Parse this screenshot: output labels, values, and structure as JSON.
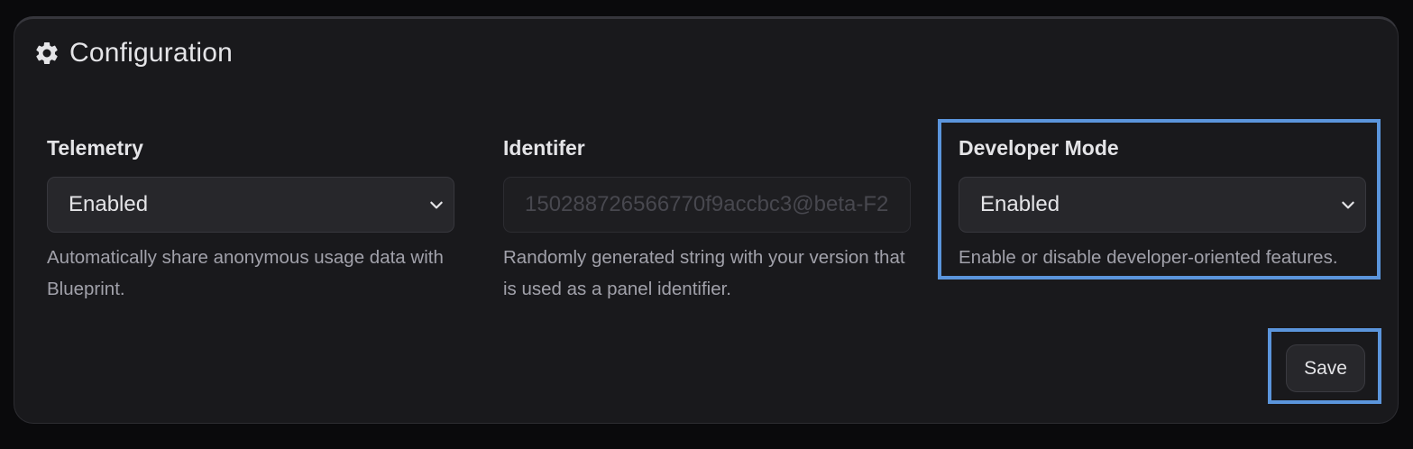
{
  "card": {
    "title": "Configuration",
    "icon": "gear-icon"
  },
  "fields": [
    {
      "label": "Telemetry",
      "type": "select",
      "value": "Enabled",
      "help": "Automatically share anonymous usage data with Blueprint."
    },
    {
      "label": "Identifer",
      "type": "text",
      "value": "150288726566770f9accbc3@beta-F2",
      "help": "Randomly generated string with your version that is used as a panel identifier."
    },
    {
      "label": "Developer Mode",
      "type": "select",
      "value": "Enabled",
      "help": "Enable or disable developer-oriented features."
    }
  ],
  "actions": {
    "save_label": "Save"
  },
  "colors": {
    "background": "#0a0a0c",
    "card": "#19191c",
    "highlight": "#5b95dc",
    "text": "#e4e4e7",
    "muted": "#a1a1aa"
  }
}
